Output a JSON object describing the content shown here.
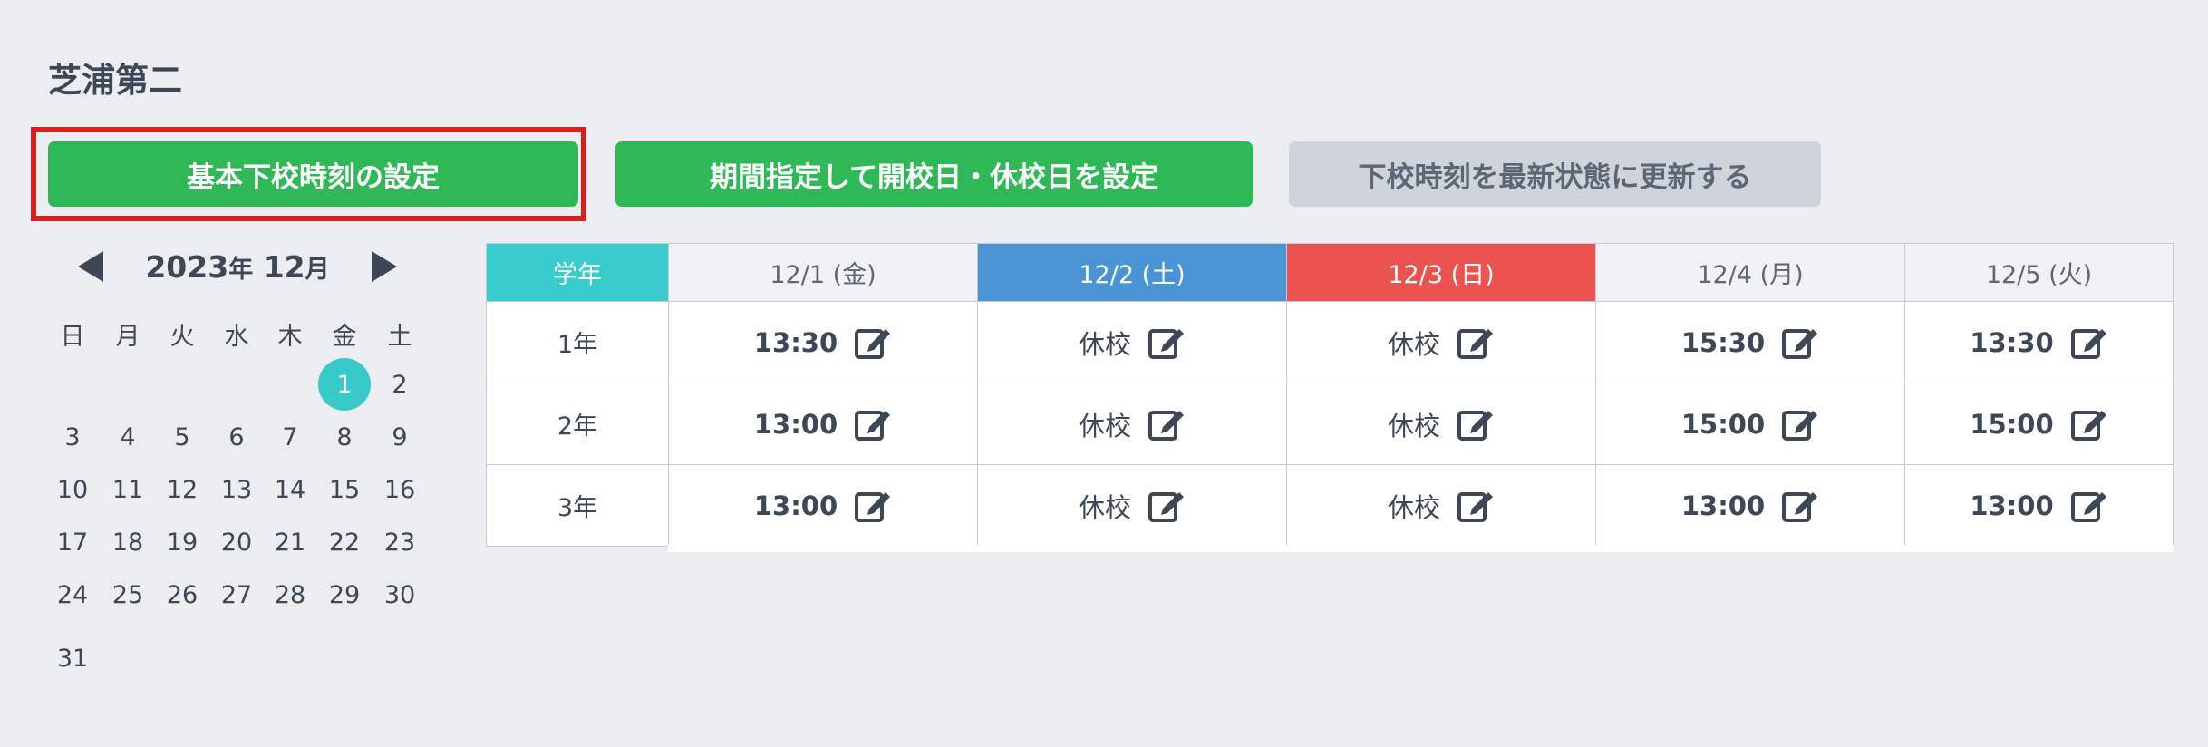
{
  "school_name": "芝浦第二",
  "buttons": {
    "basic_time": "基本下校時刻の設定",
    "period": "期間指定して開校日・休校日を設定",
    "refresh": "下校時刻を最新状態に更新する"
  },
  "calendar": {
    "year": "2023",
    "year_unit": "年",
    "month": "12",
    "month_unit": "月",
    "weekdays": [
      "日",
      "月",
      "火",
      "水",
      "木",
      "金",
      "土"
    ],
    "selected_day": "1",
    "weeks": [
      [
        "",
        "",
        "",
        "",
        "",
        "1",
        "2"
      ],
      [
        "3",
        "4",
        "5",
        "6",
        "7",
        "8",
        "9"
      ],
      [
        "10",
        "11",
        "12",
        "13",
        "14",
        "15",
        "16"
      ],
      [
        "17",
        "18",
        "19",
        "20",
        "21",
        "22",
        "23"
      ],
      [
        "24",
        "25",
        "26",
        "27",
        "28",
        "29",
        "30"
      ],
      [
        "31",
        "",
        "",
        "",
        "",
        "",
        ""
      ]
    ]
  },
  "schedule": {
    "grade_header": "学年",
    "dates": [
      {
        "label": "12/1 (金)",
        "type": "weekday"
      },
      {
        "label": "12/2 (土)",
        "type": "sat"
      },
      {
        "label": "12/3 (日)",
        "type": "sun"
      },
      {
        "label": "12/4 (月)",
        "type": "weekday"
      },
      {
        "label": "12/5 (火)",
        "type": "weekday"
      }
    ],
    "rows": [
      {
        "grade": "1年",
        "cells": [
          {
            "value": "13:30",
            "closed": false
          },
          {
            "value": "休校",
            "closed": true
          },
          {
            "value": "休校",
            "closed": true
          },
          {
            "value": "15:30",
            "closed": false
          },
          {
            "value": "13:30",
            "closed": false
          }
        ]
      },
      {
        "grade": "2年",
        "cells": [
          {
            "value": "13:00",
            "closed": false
          },
          {
            "value": "休校",
            "closed": true
          },
          {
            "value": "休校",
            "closed": true
          },
          {
            "value": "15:00",
            "closed": false
          },
          {
            "value": "15:00",
            "closed": false
          }
        ]
      },
      {
        "grade": "3年",
        "cells": [
          {
            "value": "13:00",
            "closed": false
          },
          {
            "value": "休校",
            "closed": true
          },
          {
            "value": "休校",
            "closed": true
          },
          {
            "value": "13:00",
            "closed": false
          },
          {
            "value": "13:00",
            "closed": false
          }
        ]
      }
    ]
  },
  "colors": {
    "accent_green": "#2fb956",
    "highlight_red": "#d8211a",
    "teal": "#39cccc",
    "saturday_blue": "#4a94d6",
    "sunday_red": "#ea5350"
  },
  "icons": {
    "edit": "pencil-square-icon",
    "prev": "triangle-left-icon",
    "next": "triangle-right-icon"
  }
}
